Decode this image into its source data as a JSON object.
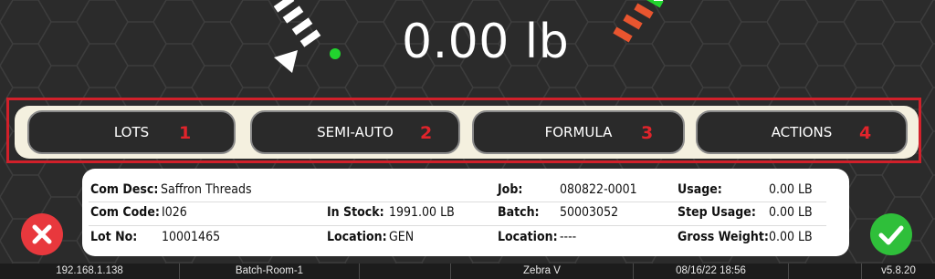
{
  "display": {
    "weight": "0.00 lb"
  },
  "actions": [
    {
      "label": "LOTS",
      "number": "1"
    },
    {
      "label": "SEMI-AUTO",
      "number": "2"
    },
    {
      "label": "FORMULA",
      "number": "3"
    },
    {
      "label": "ACTIONS",
      "number": "4"
    }
  ],
  "info": {
    "com_desc_label": "Com Desc:",
    "com_desc_value": "Saffron Threads",
    "com_code_label": "Com Code:",
    "com_code_value": "I026",
    "lot_no_label": "Lot No:",
    "lot_no_value": "10001465",
    "in_stock_label": "In Stock:",
    "in_stock_value": "1991.00 LB",
    "location_label": "Location:",
    "location_value": "GEN",
    "job_label": "Job:",
    "job_value": "080822-0001",
    "batch_label": "Batch:",
    "batch_value": "50003052",
    "location2_label": "Location:",
    "location2_value": "----",
    "usage_label": "Usage:",
    "usage_value": "0.00 LB",
    "step_usage_label": "Step Usage:",
    "step_usage_value": "0.00 LB",
    "gross_weight_label": "Gross Weight:",
    "gross_weight_value": "0.00 LB"
  },
  "status_bar": {
    "ip": "192.168.1.138",
    "room": "Batch-Room-1",
    "blank": "",
    "printer": "Zebra V",
    "datetime": "08/16/22 18:56",
    "blank2": "",
    "version": "v5.8.20"
  },
  "colors": {
    "background": "#2b2b2b",
    "highlight_frame": "#d1202a",
    "cancel": "#e8383d",
    "confirm": "#2fbf3a",
    "gauge_indicator": "#22d32e",
    "gauge_over": "#e8552f"
  },
  "icons": {
    "cancel": "close-icon",
    "confirm": "checkmark-icon"
  }
}
